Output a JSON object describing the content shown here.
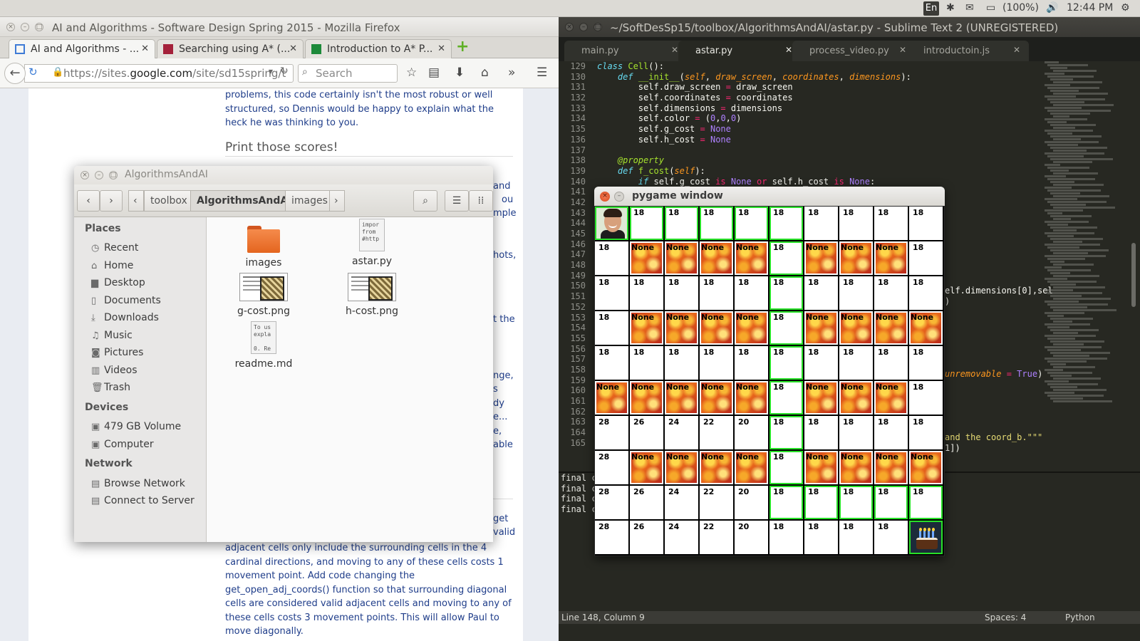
{
  "topbar": {
    "lang": "En",
    "battery": "(100%)",
    "time": "12:44 PM"
  },
  "firefox": {
    "title": "AI and Algorithms - Software Design Spring 2015 - Mozilla Firefox",
    "tabs": [
      {
        "label": "AI and Algorithms - ..."
      },
      {
        "label": "Searching using A* (..."
      },
      {
        "label": "Introduction to A* P..."
      }
    ],
    "url_prefix": "https://sites.",
    "url_domain": "google.com",
    "url_rest": "/site/sd15spring/t",
    "search_placeholder": "Search",
    "page": {
      "para1": "problems, this code certainly isn't the most robust or well structured, so Dennis would be happy to explain what the heck he was thinking to you.",
      "heading": "Print those scores!",
      "frag_and": "and",
      "frag_ou": "ou",
      "frag_mple": "mple",
      "frag_hots": "hots,",
      "frag_tthe": "t the",
      "frag_nge": "nge,",
      "frag_s": "s",
      "frag_dy": "dy",
      "frag_e": "e...",
      "frag_e2": "e,",
      "frag_able": "able",
      "frag_get": "get",
      "frag_valid": "valid",
      "para2": "adjacent cells only include the surrounding cells in the 4 cardinal directions, and moving to any of these cells costs 1 movement point. Add code changing the get_open_adj_coords() function so that surrounding diagonal cells are considered valid adjacent cells and moving to any of these cells costs 3 movement points. This will allow Paul to move diagonally."
    }
  },
  "sublime": {
    "title": "~/SoftDesSp15/toolbox/AlgorithmsAndAI/astar.py - Sublime Text 2 (UNREGISTERED)",
    "tabs": [
      {
        "label": "main.py"
      },
      {
        "label": "astar.py"
      },
      {
        "label": "process_video.py"
      },
      {
        "label": "introductoin.js"
      }
    ],
    "line_numbers": [
      "129",
      "130",
      "131",
      "132",
      "133",
      "134",
      "135",
      "136",
      "137",
      "138",
      "139",
      "140",
      "141",
      "142",
      "143",
      "144",
      "145",
      "146",
      "147",
      "148",
      "149",
      "150",
      "151",
      "152",
      "153",
      "154",
      "155",
      "156",
      "157",
      "158",
      "159",
      "160",
      "161",
      "162",
      "163",
      "164",
      "165"
    ],
    "code_fragments": {
      "dims": "elf.dimensions[0],sel",
      "paren": ")",
      "unremovable": "unremovable",
      "eq": " = ",
      "true": "True",
      "close": ")",
      "coordb": "and the coord_b.\"\"\"",
      "bracket": "1])"
    },
    "console": [
      "final c",
      "final c",
      "final c",
      "final c"
    ],
    "status_left": "Line 148, Column 9",
    "status_spaces": "Spaces: 4",
    "status_lang": "Python"
  },
  "filemanager": {
    "title": "AlgorithmsAndAI",
    "crumbs": [
      "toolbox",
      "AlgorithmsAndAI",
      "images"
    ],
    "places_header": "Places",
    "places": [
      "Recent",
      "Home",
      "Desktop",
      "Documents",
      "Downloads",
      "Music",
      "Pictures",
      "Videos",
      "Trash"
    ],
    "devices_header": "Devices",
    "devices": [
      "479 GB Volume",
      "Computer"
    ],
    "network_header": "Network",
    "network": [
      "Browse Network",
      "Connect to Server"
    ],
    "files": [
      {
        "name": "images"
      },
      {
        "name": "astar.py",
        "preview": "impor\nfrom\n#http"
      },
      {
        "name": "g-cost.png"
      },
      {
        "name": "h-cost.png"
      },
      {
        "name": "readme.md",
        "preview": "To us\nexpla\n\n0. Re"
      }
    ]
  },
  "pygame": {
    "title": "pygame window",
    "rows": [
      [
        "S",
        "18",
        "18",
        "18",
        "18",
        "18",
        "18",
        "18",
        "18",
        "18"
      ],
      [
        "18",
        "None",
        "None",
        "None",
        "None",
        "18",
        "None",
        "None",
        "None",
        "18"
      ],
      [
        "18",
        "18",
        "18",
        "18",
        "18",
        "18",
        "18",
        "18",
        "18",
        "18"
      ],
      [
        "18",
        "None",
        "None",
        "None",
        "None",
        "18",
        "None",
        "None",
        "None",
        "None"
      ],
      [
        "18",
        "18",
        "18",
        "18",
        "18",
        "18",
        "18",
        "18",
        "18",
        "18"
      ],
      [
        "None",
        "None",
        "None",
        "None",
        "None",
        "18",
        "None",
        "None",
        "None",
        "18"
      ],
      [
        "28",
        "26",
        "24",
        "22",
        "20",
        "18",
        "18",
        "18",
        "18",
        "18"
      ],
      [
        "28",
        "None",
        "None",
        "None",
        "None",
        "18",
        "None",
        "None",
        "None",
        "None"
      ],
      [
        "28",
        "26",
        "24",
        "22",
        "20",
        "18",
        "18",
        "18",
        "18",
        "18"
      ],
      [
        "28",
        "26",
        "24",
        "22",
        "20",
        "18",
        "18",
        "18",
        "18",
        "G"
      ]
    ],
    "path": [
      [
        0,
        0
      ],
      [
        0,
        1
      ],
      [
        0,
        2
      ],
      [
        0,
        3
      ],
      [
        0,
        4
      ],
      [
        0,
        5
      ],
      [
        1,
        5
      ],
      [
        2,
        5
      ],
      [
        3,
        5
      ],
      [
        4,
        5
      ],
      [
        5,
        5
      ],
      [
        6,
        5
      ],
      [
        7,
        5
      ],
      [
        8,
        5
      ],
      [
        8,
        6
      ],
      [
        8,
        7
      ],
      [
        8,
        8
      ],
      [
        8,
        9
      ],
      [
        9,
        9
      ]
    ]
  }
}
